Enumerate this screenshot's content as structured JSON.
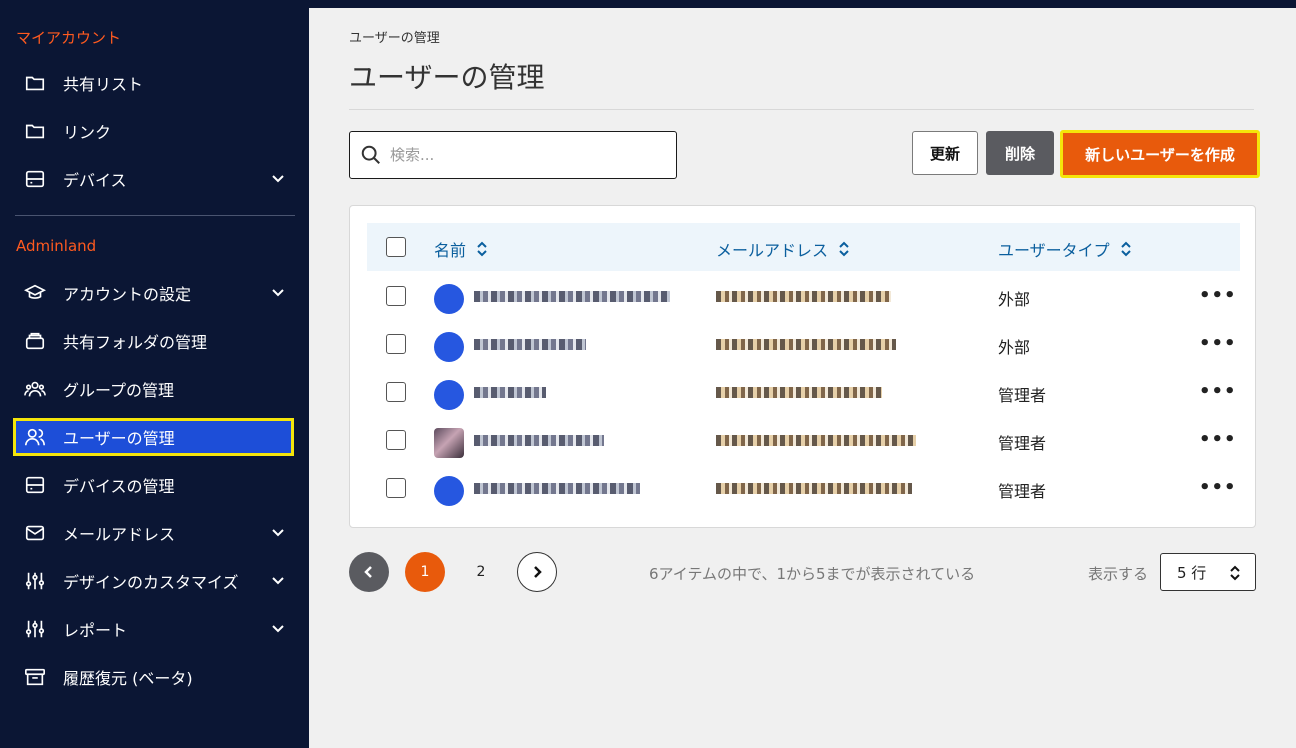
{
  "sidebar": {
    "section_account": "マイアカウント",
    "section_admin": "Adminland",
    "account_items": [
      {
        "label": "共有リスト",
        "icon": "folder-icon"
      },
      {
        "label": "リンク",
        "icon": "folder-icon"
      },
      {
        "label": "デバイス",
        "icon": "device-icon",
        "expandable": true
      }
    ],
    "admin_items": [
      {
        "label": "アカウントの設定",
        "icon": "graduation-cap-icon",
        "expandable": true
      },
      {
        "label": "共有フォルダの管理",
        "icon": "shared-folder-icon"
      },
      {
        "label": "グループの管理",
        "icon": "group-icon"
      },
      {
        "label": "ユーザーの管理",
        "icon": "users-icon",
        "active": true
      },
      {
        "label": "デバイスの管理",
        "icon": "device-icon"
      },
      {
        "label": "メールアドレス",
        "icon": "mail-icon",
        "expandable": true
      },
      {
        "label": "デザインのカスタマイズ",
        "icon": "sliders-icon",
        "expandable": true
      },
      {
        "label": "レポート",
        "icon": "sliders-icon",
        "expandable": true
      },
      {
        "label": "履歴復元 (ベータ)",
        "icon": "archive-icon"
      }
    ]
  },
  "main": {
    "breadcrumb": "ユーザーの管理",
    "title": "ユーザーの管理",
    "search_placeholder": "検索...",
    "buttons": {
      "refresh": "更新",
      "delete": "削除",
      "create": "新しいユーザーを作成"
    },
    "columns": {
      "name": "名前",
      "email": "メールアドレス",
      "type": "ユーザータイプ"
    },
    "rows": [
      {
        "type": "外部"
      },
      {
        "type": "外部"
      },
      {
        "type": "管理者"
      },
      {
        "type": "管理者"
      },
      {
        "type": "管理者"
      }
    ],
    "more_label": "•••",
    "pagination": {
      "current": "1",
      "next_page": "2",
      "info": "6アイテムの中で、1から5までが表示されている",
      "rows_label": "表示する",
      "rows_value": "5 行"
    }
  },
  "colors": {
    "sidebar_bg": "#0b1634",
    "accent": "#e85a0c",
    "active": "#1d4ed8",
    "highlight": "#f5e50a"
  }
}
